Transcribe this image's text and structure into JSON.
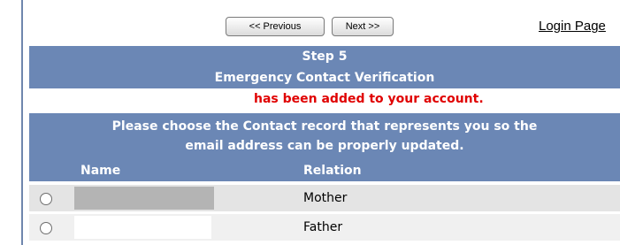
{
  "nav": {
    "previous_label": "<< Previous",
    "next_label": "Next >>",
    "login_link": "Login Page"
  },
  "header": {
    "step": "Step 5",
    "title": "Emergency Contact Verification"
  },
  "error": "has been added to your account.",
  "instructions": {
    "line1": "Please choose the Contact record that represents you so the",
    "line2": "email address can be properly updated."
  },
  "table": {
    "columns": [
      "Name",
      "Relation"
    ],
    "rows": [
      {
        "relation": "Mother",
        "selected": false
      },
      {
        "relation": "Father",
        "selected": false
      }
    ]
  }
}
